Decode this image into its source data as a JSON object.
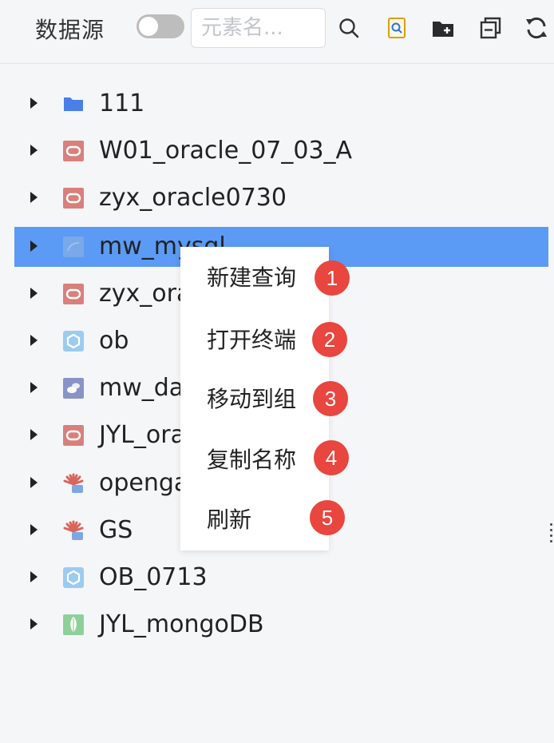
{
  "toolbar": {
    "title": "数据源",
    "toggle_state": "off",
    "search_placeholder": "元素名...",
    "icons": [
      "search-icon",
      "find-file-icon",
      "new-folder-icon",
      "collapse-icon",
      "refresh-icon"
    ]
  },
  "tree": {
    "items": [
      {
        "label": "111",
        "icon": "folder-icon",
        "selected": false
      },
      {
        "label": "W01_oracle_07_03_A",
        "icon": "oracle-icon",
        "selected": false
      },
      {
        "label": "zyx_oracle0730",
        "icon": "oracle-icon",
        "selected": false
      },
      {
        "label": "mw_mysql",
        "icon": "mysql-icon",
        "selected": true
      },
      {
        "label": "zyx_ora",
        "icon": "oracle-icon",
        "selected": false
      },
      {
        "label": "ob",
        "icon": "oceanbase-icon",
        "selected": false
      },
      {
        "label": "mw_da",
        "icon": "dameng-icon",
        "selected": false
      },
      {
        "label": "JYL_ora",
        "icon": "oracle-icon",
        "selected": false
      },
      {
        "label": "openga",
        "icon": "opengauss-icon",
        "selected": false
      },
      {
        "label": "GS",
        "icon": "opengauss-icon",
        "selected": false
      },
      {
        "label": "OB_0713",
        "icon": "oceanbase-icon",
        "selected": false
      },
      {
        "label": "JYL_mongoDB",
        "icon": "mongodb-icon",
        "selected": false
      }
    ]
  },
  "context_menu": {
    "items": [
      {
        "label": "新建查询",
        "badge": "1"
      },
      {
        "label": "打开终端",
        "badge": "2"
      },
      {
        "label": "移动到组",
        "badge": "3"
      },
      {
        "label": "复制名称",
        "badge": "4"
      },
      {
        "label": "刷新",
        "badge": "5"
      }
    ]
  },
  "colors": {
    "selected_row": "#5b9af5",
    "badge": "#e8463f",
    "oracle": "#d9534f",
    "folder": "#4a7ee8",
    "mongodb": "#4caf50"
  }
}
